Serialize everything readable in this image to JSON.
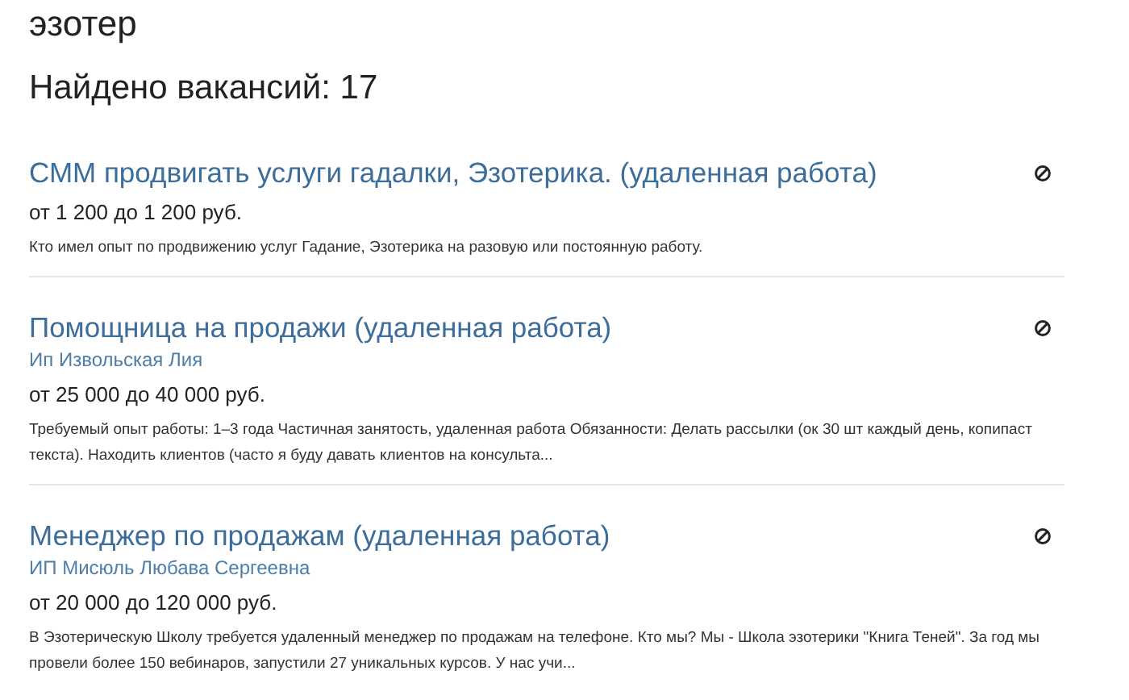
{
  "query": "эзотер",
  "results_heading": "Найдено вакансий: 17",
  "vacancies": [
    {
      "title": "СММ продвигать услуги гадалки, Эзотерика. (удаленная работа)",
      "salary": "от 1 200 до 1 200 руб.",
      "description": "Кто имел опыт по продвижению услуг Гадание, Эзотерика на разовую или постоянную работу."
    },
    {
      "title": "Помощница на продажи (удаленная работа)",
      "company": "Ип Извольская Лия",
      "salary": "от 25 000 до 40 000 руб.",
      "description": "Требуемый опыт работы: 1–3 года Частичная занятость, удаленная работа Обязанности: Делать рассылки (ок 30 шт каждый день, копипаст текста). Находить клиентов (часто я буду давать клиентов на консульта..."
    },
    {
      "title": "Менеджер по продажам (удаленная работа)",
      "company": "ИП Мисюль Любава Сергеевна",
      "salary": "от 20 000 до 120 000 руб.",
      "description": "В Эзотерическую Школу требуется удаленный менеджер по продажам на телефоне. Кто мы? Мы - Школа эзотерики \"Книга Теней\". За год мы провели более 150 вебинаров, запустили 27 уникальных курсов. У нас учи..."
    }
  ]
}
